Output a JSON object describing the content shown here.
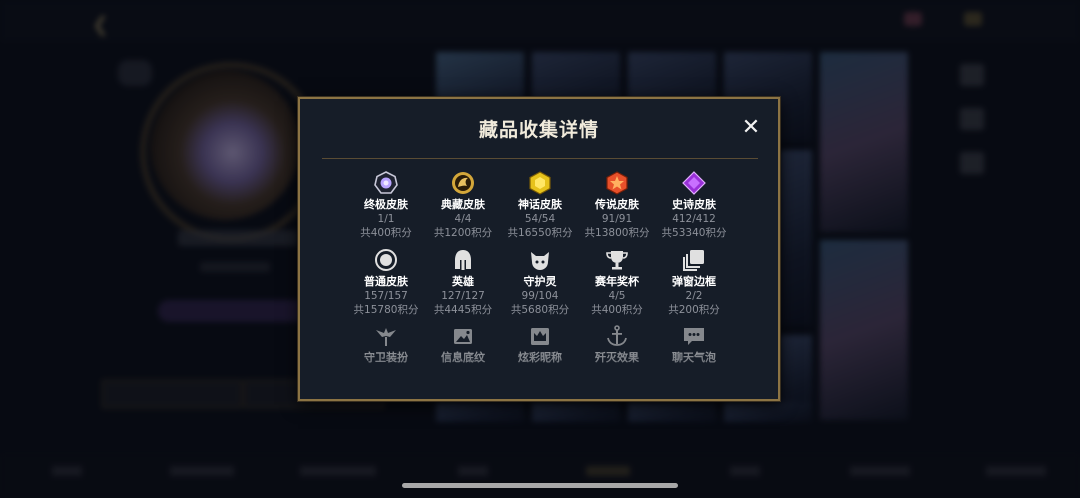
{
  "modal": {
    "title": "藏品收集详情",
    "close_glyph": "✕"
  },
  "rows": [
    [
      {
        "icon": "ultimate-skin-icon",
        "name": "终极皮肤",
        "count": "1/1",
        "points": "共400积分"
      },
      {
        "icon": "classic-skin-icon",
        "name": "典藏皮肤",
        "count": "4/4",
        "points": "共1200积分"
      },
      {
        "icon": "mythic-skin-icon",
        "name": "神话皮肤",
        "count": "54/54",
        "points": "共16550积分"
      },
      {
        "icon": "legendary-skin-icon",
        "name": "传说皮肤",
        "count": "91/91",
        "points": "共13800积分"
      },
      {
        "icon": "epic-skin-icon",
        "name": "史诗皮肤",
        "count": "412/412",
        "points": "共53340积分"
      }
    ],
    [
      {
        "icon": "normal-skin-icon",
        "name": "普通皮肤",
        "count": "157/157",
        "points": "共15780积分"
      },
      {
        "icon": "champion-helmet-icon",
        "name": "英雄",
        "count": "127/127",
        "points": "共4445积分"
      },
      {
        "icon": "guardian-pet-icon",
        "name": "守护灵",
        "count": "99/104",
        "points": "共5680积分"
      },
      {
        "icon": "trophy-icon",
        "name": "赛年奖杯",
        "count": "4/5",
        "points": "共400积分"
      },
      {
        "icon": "popup-frame-icon",
        "name": "弹窗边框",
        "count": "2/2",
        "points": "共200积分"
      }
    ],
    [
      {
        "icon": "ward-icon",
        "name": "守卫装扮"
      },
      {
        "icon": "info-pattern-icon",
        "name": "信息底纹"
      },
      {
        "icon": "title-crown-icon",
        "name": "炫彩昵称"
      },
      {
        "icon": "anchor-icon",
        "name": "歼灭效果"
      },
      {
        "icon": "chat-bubble-icon",
        "name": "聊天气泡"
      }
    ]
  ],
  "colors": {
    "accent_gold": "#8c7444",
    "modal_bg": "#161d28",
    "muted_text": "#8d919a"
  }
}
